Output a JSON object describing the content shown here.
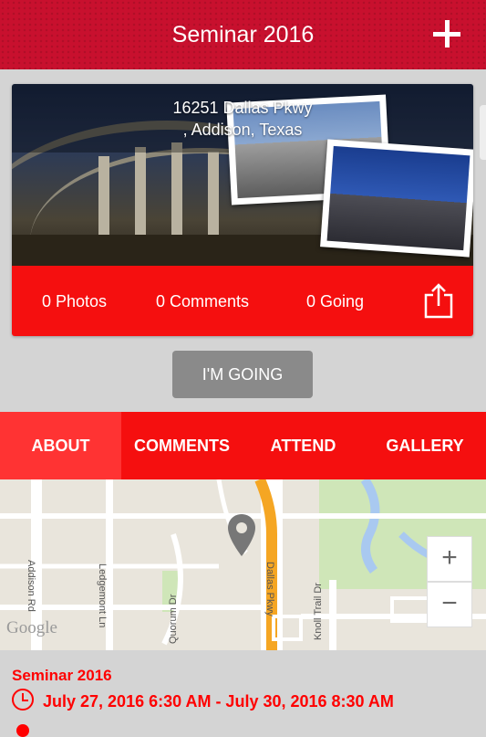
{
  "header": {
    "title": "Seminar 2016",
    "add_icon": "plus-icon"
  },
  "event_card": {
    "address_line1": "16251 Dallas Pkwy",
    "address_line2": ", Addison, Texas",
    "photos": "0 Photos",
    "comments": "0 Comments",
    "going": "0 Going",
    "share_icon": "share-icon"
  },
  "going_button": "I'M GOING",
  "tabs": [
    {
      "label": "ABOUT",
      "active": true
    },
    {
      "label": "COMMENTS",
      "active": false
    },
    {
      "label": "ATTEND",
      "active": false
    },
    {
      "label": "GALLERY",
      "active": false
    }
  ],
  "map": {
    "streets": [
      "Addison Rd",
      "Ledgemont Ln",
      "Quorum Dr",
      "Dallas Pkwy",
      "Knoll Trail Dr"
    ],
    "attribution": "Google",
    "zoom_in": "+",
    "zoom_out": "−"
  },
  "details": {
    "title": "Seminar 2016",
    "date_range": "July 27, 2016 6:30 AM - July 30, 2016 8:30 AM"
  },
  "colors": {
    "brand_red": "#f50f0f",
    "header_red": "#c8102e",
    "button_gray": "#8a8a8a"
  }
}
